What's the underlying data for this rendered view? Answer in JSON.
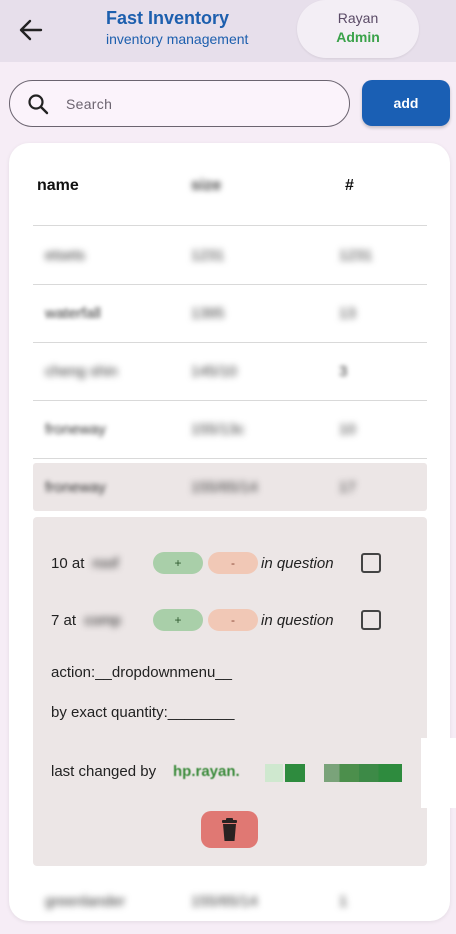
{
  "header": {
    "title": "Fast Inventory",
    "subtitle": "inventory management",
    "user": {
      "name": "Rayan",
      "role": "Admin"
    }
  },
  "search": {
    "placeholder": "Search"
  },
  "add_label": "add",
  "table": {
    "headers": [
      "name",
      "size",
      "#"
    ],
    "rows": [
      {
        "name": "etsets",
        "size": "1231",
        "count": "1231"
      },
      {
        "name": "waterfall",
        "size": "1395",
        "count": "13"
      },
      {
        "name": "cheng shin",
        "size": "145/10",
        "count": "3"
      },
      {
        "name": "froneway",
        "size": "155/13c",
        "count": "10"
      },
      {
        "name": "froneway",
        "size": "155/65/14",
        "count": "17"
      },
      {
        "name": "greenlander",
        "size": "155/65/14",
        "count": "1"
      }
    ]
  },
  "details": {
    "line1_prefix": "10 at",
    "line1_blur": "roof",
    "line2_prefix": "7 at",
    "line2_blur": "comp",
    "plus_label": "+",
    "minus_label": "-",
    "in_question": "in question",
    "action": "action:__dropdownmenu__",
    "by_exact": "by exact quantity:________",
    "last_changed": "last changed by",
    "last_changed_user": "hp.rayan."
  },
  "colors": {
    "brand_blue": "#1a5fb4",
    "admin_green": "#3aa24a",
    "delete_red": "#e07873"
  },
  "icons": {
    "back": "arrow-left",
    "search": "magnifier",
    "delete": "trash"
  }
}
